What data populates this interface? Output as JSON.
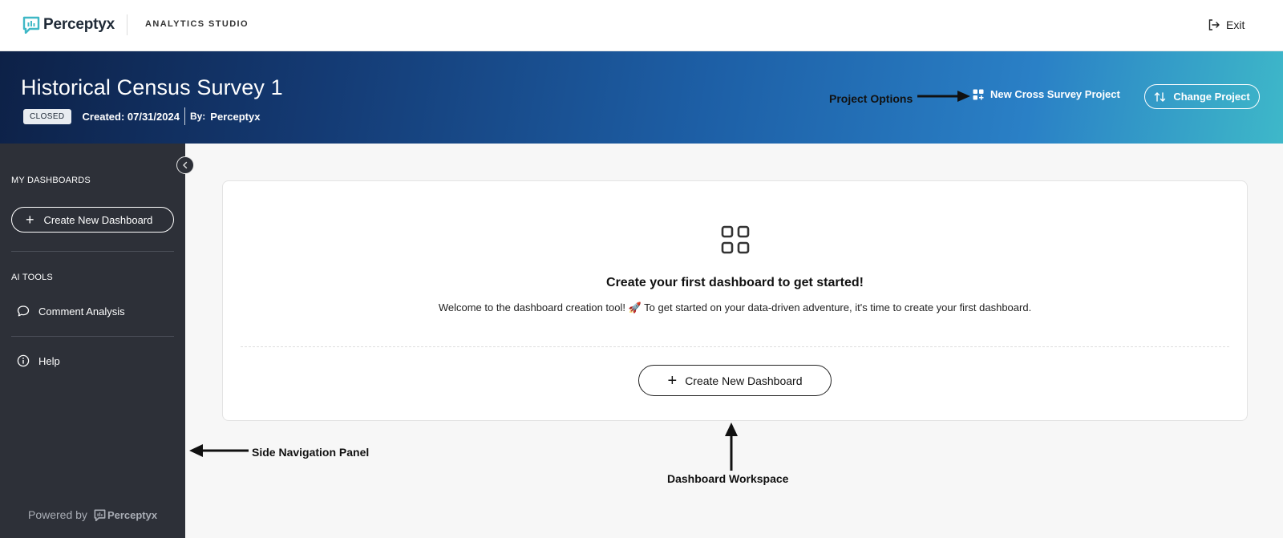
{
  "topbar": {
    "logo_text": "Perceptyx",
    "studio_label": "ANALYTICS STUDIO",
    "exit_label": "Exit"
  },
  "banner": {
    "title": "Historical Census Survey 1",
    "status": "CLOSED",
    "created": "Created: 07/31/2024",
    "by_label": "By:",
    "by_value": "Perceptyx",
    "cross_survey_label": "New Cross Survey Project",
    "change_project_label": "Change Project"
  },
  "sidebar": {
    "my_dashboards_label": "MY DASHBOARDS",
    "create_label": "Create New Dashboard",
    "ai_tools_label": "AI TOOLS",
    "items": [
      {
        "label": "Comment Analysis",
        "icon": "chat-bubble-icon"
      },
      {
        "label": "Help",
        "icon": "info-icon"
      }
    ],
    "powered_label": "Powered by",
    "powered_logo": "Perceptyx"
  },
  "workspace": {
    "heading": "Create your first dashboard to get started!",
    "text": "Welcome to the dashboard creation tool! 🚀 To get started on your data-driven adventure, it's time to create your first dashboard.",
    "create_label": "Create New Dashboard"
  },
  "annotations": {
    "project_options": "Project Options",
    "side_nav": "Side Navigation Panel",
    "workspace": "Dashboard Workspace"
  },
  "colors": {
    "brand_teal": "#3fb8c6",
    "sidebar_bg": "#2d3038",
    "banner_start": "#0d2147",
    "banner_end": "#3eb8c9"
  }
}
